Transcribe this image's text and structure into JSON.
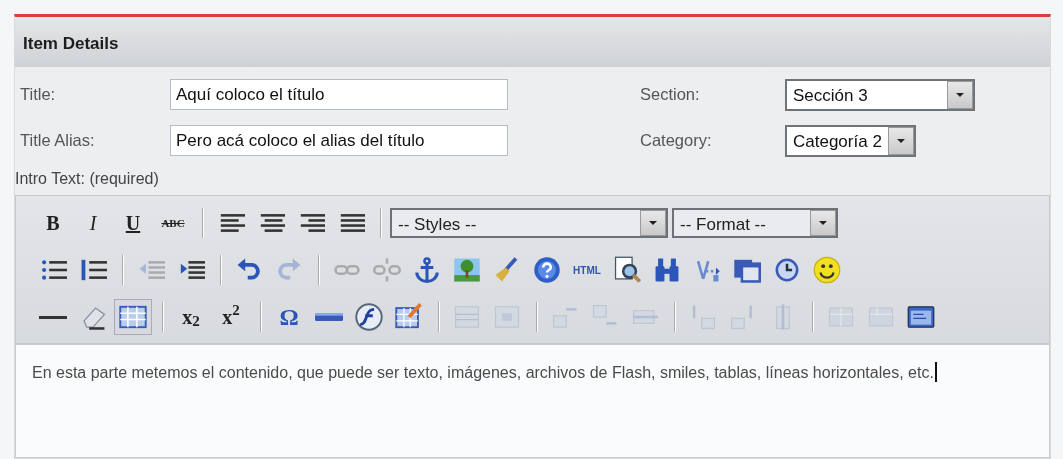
{
  "panel": {
    "title": "Item Details"
  },
  "fields": [
    {
      "label": "Title:",
      "value": "Aquí coloco el título"
    },
    {
      "label": "Title Alias:",
      "value": "Pero acá coloco el alias del título"
    }
  ],
  "selects": [
    {
      "label": "Section:",
      "value": "Sección 3"
    },
    {
      "label": "Category:",
      "value": "Categoría 2"
    }
  ],
  "editor": {
    "label": "Intro Text: (required)",
    "content": "En esta parte metemos el contenido, que puede ser texto, imágenes, archivos de Flash, smiles, tablas, líneas horizontales, etc.",
    "cursor": true,
    "toolbar_rows": [
      [
        {
          "kind": "text",
          "label": "B",
          "disabled": false
        },
        {
          "kind": "text",
          "label": "I",
          "disabled": false
        },
        {
          "kind": "text",
          "label": "U",
          "disabled": false
        },
        {
          "kind": "text",
          "label": "ABC",
          "disabled": false
        },
        {
          "kind": "separator"
        },
        {
          "kind": "icon",
          "disabled": false
        },
        {
          "kind": "icon",
          "disabled": false
        },
        {
          "kind": "icon",
          "disabled": false
        },
        {
          "kind": "icon",
          "disabled": false
        },
        {
          "kind": "separator"
        },
        {
          "kind": "select",
          "value": "-- Styles --"
        },
        {
          "kind": "select",
          "value": "-- Format --"
        }
      ],
      [
        {
          "kind": "icon",
          "disabled": false
        },
        {
          "kind": "icon",
          "disabled": false
        },
        {
          "kind": "separator"
        },
        {
          "kind": "icon",
          "disabled": true
        },
        {
          "kind": "icon",
          "disabled": false
        },
        {
          "kind": "separator"
        },
        {
          "kind": "icon",
          "disabled": false
        },
        {
          "kind": "icon",
          "disabled": true
        },
        {
          "kind": "separator"
        },
        {
          "kind": "icon",
          "disabled": true
        },
        {
          "kind": "icon",
          "disabled": true
        },
        {
          "kind": "icon",
          "disabled": false
        },
        {
          "kind": "icon",
          "disabled": false
        },
        {
          "kind": "icon",
          "disabled": false
        },
        {
          "kind": "icon",
          "disabled": false
        },
        {
          "kind": "text",
          "label": "HTML",
          "disabled": false
        },
        {
          "kind": "icon",
          "disabled": false
        },
        {
          "kind": "icon",
          "disabled": false
        },
        {
          "kind": "icon",
          "disabled": false
        },
        {
          "kind": "icon",
          "disabled": false
        },
        {
          "kind": "icon",
          "disabled": false
        },
        {
          "kind": "icon",
          "disabled": false
        }
      ],
      [
        {
          "kind": "icon",
          "disabled": false
        },
        {
          "kind": "icon",
          "disabled": false
        },
        {
          "kind": "icon",
          "disabled": false,
          "active": true
        },
        {
          "kind": "separator"
        },
        {
          "kind": "text",
          "label": "x$_{2}$",
          "disabled": false
        },
        {
          "kind": "text",
          "label": "x$^{2}$",
          "disabled": false
        },
        {
          "kind": "separator"
        },
        {
          "kind": "text",
          "label": "Ω",
          "disabled": false
        },
        {
          "kind": "icon",
          "disabled": false
        },
        {
          "kind": "icon",
          "disabled": false
        },
        {
          "kind": "icon",
          "disabled": false
        },
        {
          "kind": "separator"
        },
        {
          "kind": "icon",
          "disabled": true
        },
        {
          "kind": "icon",
          "disabled": true
        },
        {
          "kind": "separator"
        },
        {
          "kind": "icon",
          "disabled": true
        },
        {
          "kind": "icon",
          "disabled": true
        },
        {
          "kind": "icon",
          "disabled": true
        },
        {
          "kind": "separator"
        },
        {
          "kind": "icon",
          "disabled": true
        },
        {
          "kind": "icon",
          "disabled": true
        },
        {
          "kind": "icon",
          "disabled": true
        },
        {
          "kind": "separator"
        },
        {
          "kind": "icon",
          "disabled": true
        },
        {
          "kind": "icon",
          "disabled": true
        },
        {
          "kind": "icon",
          "disabled": false
        }
      ]
    ]
  }
}
